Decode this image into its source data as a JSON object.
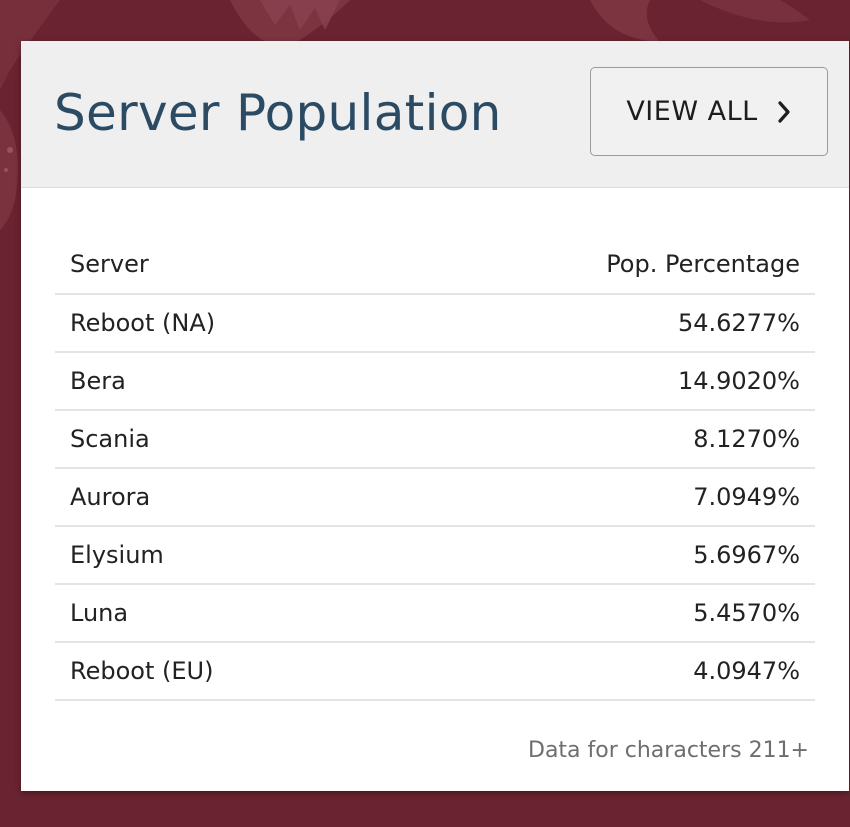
{
  "card": {
    "title": "Server Population",
    "view_all_label": "VIEW ALL",
    "view_all_icon": "chevron-right-icon"
  },
  "table": {
    "columns": [
      "Server",
      "Pop. Percentage"
    ],
    "rows": [
      {
        "server": "Reboot (NA)",
        "percentage": "54.6277%"
      },
      {
        "server": "Bera",
        "percentage": "14.9020%"
      },
      {
        "server": "Scania",
        "percentage": "8.1270%"
      },
      {
        "server": "Aurora",
        "percentage": "7.0949%"
      },
      {
        "server": "Elysium",
        "percentage": "5.6967%"
      },
      {
        "server": "Luna",
        "percentage": "5.4570%"
      },
      {
        "server": "Reboot (EU)",
        "percentage": "4.0947%"
      }
    ]
  },
  "footnote": "Data for characters 211+",
  "colors": {
    "background": "#6a2330",
    "title": "#2b4a63",
    "header_band": "#efefef"
  }
}
